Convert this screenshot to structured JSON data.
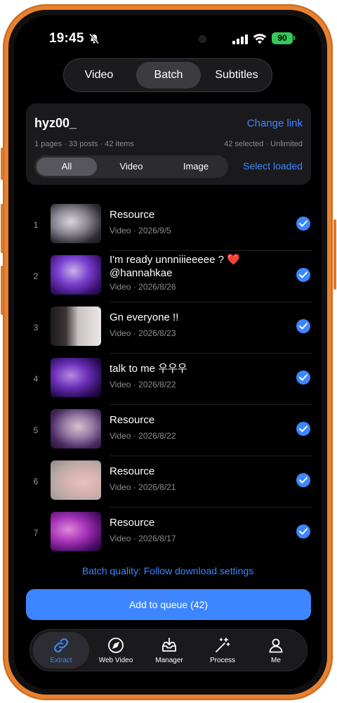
{
  "status_bar": {
    "time": "19:45",
    "battery": "90"
  },
  "segments": [
    {
      "label": "Video",
      "active": false
    },
    {
      "label": "Batch",
      "active": true
    },
    {
      "label": "Subtitles",
      "active": false
    }
  ],
  "account": {
    "username": "hyz00_",
    "change_link": "Change link",
    "meta": "1 pages · 33 posts · 42 items",
    "selection_info": "42 selected · Unlimited",
    "filters": [
      {
        "label": "All",
        "active": true
      },
      {
        "label": "Video",
        "active": false
      },
      {
        "label": "Image",
        "active": false
      }
    ],
    "select_loaded": "Select loaded"
  },
  "items": [
    {
      "index": "1",
      "title": "Resource",
      "subtitle": "Video · 2026/9/5",
      "selected": true
    },
    {
      "index": "2",
      "title": "I'm ready unnniiieeeee ? ❤️ @hannahkae",
      "subtitle": "Video · 2026/8/26",
      "selected": true
    },
    {
      "index": "3",
      "title": "Gn everyone !!",
      "subtitle": "Video · 2026/8/23",
      "selected": true
    },
    {
      "index": "4",
      "title": "talk to me 우우우",
      "subtitle": "Video · 2026/8/22",
      "selected": true
    },
    {
      "index": "5",
      "title": "Resource",
      "subtitle": "Video · 2026/8/22",
      "selected": true
    },
    {
      "index": "6",
      "title": "Resource",
      "subtitle": "Video · 2026/8/21",
      "selected": true
    },
    {
      "index": "7",
      "title": "Resource",
      "subtitle": "Video · 2026/8/17",
      "selected": true
    }
  ],
  "batch_quality": "Batch quality: Follow download settings",
  "queue_button": "Add to queue (42)",
  "tabs": [
    {
      "label": "Extract",
      "icon": "link-icon",
      "active": true
    },
    {
      "label": "Web Video",
      "icon": "compass-icon",
      "active": false
    },
    {
      "label": "Manager",
      "icon": "tray-download-icon",
      "active": false
    },
    {
      "label": "Process",
      "icon": "magic-wand-icon",
      "active": false
    },
    {
      "label": "Me",
      "icon": "person-icon",
      "active": false
    }
  ],
  "colors": {
    "accent": "#3d86ff",
    "frame": "#e8812f",
    "battery": "#35c759"
  }
}
